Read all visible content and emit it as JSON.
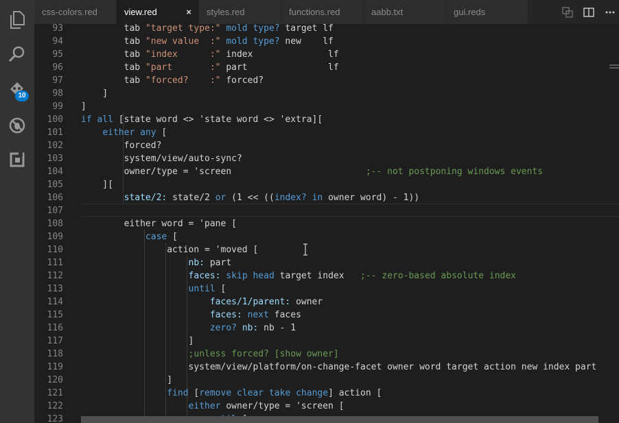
{
  "activity_bar": {
    "items": [
      {
        "name": "explorer-icon"
      },
      {
        "name": "search-icon"
      },
      {
        "name": "source-control-icon",
        "badge": "10"
      },
      {
        "name": "debug-icon"
      },
      {
        "name": "extensions-icon"
      }
    ]
  },
  "tabs": [
    {
      "label": "css-colors.red",
      "active": false
    },
    {
      "label": "view.red",
      "active": true,
      "close": "×"
    },
    {
      "label": "styles.red",
      "active": false
    },
    {
      "label": "functions.red",
      "active": false
    },
    {
      "label": "aabb.txt",
      "active": false
    },
    {
      "label": "gui.reds",
      "active": false
    }
  ],
  "tab_actions": [
    "open-changes-icon",
    "split-editor-icon",
    "more-actions-icon"
  ],
  "editor": {
    "lines": [
      {
        "n": "93",
        "tokens": [
          [
            "t",
            "        tab "
          ],
          [
            "s",
            "\"target type:\""
          ],
          [
            "t",
            " "
          ],
          [
            "k",
            "mold"
          ],
          [
            "t",
            " "
          ],
          [
            "k",
            "type?"
          ],
          [
            "t",
            " target "
          ],
          [
            "t",
            "lf"
          ]
        ]
      },
      {
        "n": "94",
        "tokens": [
          [
            "t",
            "        tab "
          ],
          [
            "s",
            "\"new value  :\""
          ],
          [
            "t",
            " "
          ],
          [
            "k",
            "mold"
          ],
          [
            "t",
            " "
          ],
          [
            "k",
            "type?"
          ],
          [
            "t",
            " new    "
          ],
          [
            "t",
            "lf"
          ]
        ]
      },
      {
        "n": "95",
        "tokens": [
          [
            "t",
            "        tab "
          ],
          [
            "s",
            "\"index      :\""
          ],
          [
            "t",
            " index              "
          ],
          [
            "t",
            "lf"
          ]
        ]
      },
      {
        "n": "96",
        "tokens": [
          [
            "t",
            "        tab "
          ],
          [
            "s",
            "\"part       :\""
          ],
          [
            "t",
            " part               "
          ],
          [
            "t",
            "lf"
          ]
        ]
      },
      {
        "n": "97",
        "tokens": [
          [
            "t",
            "        tab "
          ],
          [
            "s",
            "\"forced?    :\""
          ],
          [
            "t",
            " forced?"
          ]
        ]
      },
      {
        "n": "98",
        "tokens": [
          [
            "t",
            "    ]"
          ]
        ]
      },
      {
        "n": "99",
        "tokens": [
          [
            "t",
            "]"
          ]
        ]
      },
      {
        "n": "100",
        "tokens": [
          [
            "k",
            "if"
          ],
          [
            "t",
            " "
          ],
          [
            "k",
            "all"
          ],
          [
            "t",
            " [state word <> 'state word <> 'extra]["
          ]
        ]
      },
      {
        "n": "101",
        "tokens": [
          [
            "t",
            "    "
          ],
          [
            "k",
            "either"
          ],
          [
            "t",
            " "
          ],
          [
            "k",
            "any"
          ],
          [
            "t",
            " ["
          ]
        ]
      },
      {
        "n": "102",
        "tokens": [
          [
            "t",
            "        forced?"
          ]
        ]
      },
      {
        "n": "103",
        "tokens": [
          [
            "t",
            "        system/view/auto-sync?"
          ]
        ]
      },
      {
        "n": "104",
        "tokens": [
          [
            "t",
            "        owner/type = 'screen                         "
          ],
          [
            "c",
            ";-- not postponing windows events"
          ]
        ]
      },
      {
        "n": "105",
        "tokens": [
          [
            "t",
            "    ]["
          ]
        ]
      },
      {
        "n": "106",
        "tokens": [
          [
            "t",
            "        "
          ],
          [
            "w",
            "state/2:"
          ],
          [
            "t",
            " state/2 "
          ],
          [
            "k",
            "or"
          ],
          [
            "t",
            " (1 << (("
          ],
          [
            "k",
            "index?"
          ],
          [
            "t",
            " "
          ],
          [
            "k",
            "in"
          ],
          [
            "t",
            " owner word) - 1))"
          ]
        ]
      },
      {
        "n": "107",
        "tokens": []
      },
      {
        "n": "108",
        "tokens": [
          [
            "t",
            "        either word = 'pane ["
          ]
        ]
      },
      {
        "n": "109",
        "tokens": [
          [
            "t",
            "            "
          ],
          [
            "k",
            "case"
          ],
          [
            "t",
            " ["
          ]
        ]
      },
      {
        "n": "110",
        "tokens": [
          [
            "t",
            "                action = 'moved ["
          ]
        ]
      },
      {
        "n": "111",
        "tokens": [
          [
            "t",
            "                    "
          ],
          [
            "w",
            "nb:"
          ],
          [
            "t",
            " part"
          ]
        ]
      },
      {
        "n": "112",
        "tokens": [
          [
            "t",
            "                    "
          ],
          [
            "w",
            "faces:"
          ],
          [
            "t",
            " "
          ],
          [
            "k",
            "skip"
          ],
          [
            "t",
            " "
          ],
          [
            "k",
            "head"
          ],
          [
            "t",
            " target index   "
          ],
          [
            "c",
            ";-- zero-based absolute index"
          ]
        ]
      },
      {
        "n": "113",
        "tokens": [
          [
            "t",
            "                    "
          ],
          [
            "k",
            "until"
          ],
          [
            "t",
            " ["
          ]
        ]
      },
      {
        "n": "114",
        "tokens": [
          [
            "t",
            "                        "
          ],
          [
            "w",
            "faces/1/parent:"
          ],
          [
            "t",
            " owner"
          ]
        ]
      },
      {
        "n": "115",
        "tokens": [
          [
            "t",
            "                        "
          ],
          [
            "w",
            "faces:"
          ],
          [
            "t",
            " "
          ],
          [
            "k",
            "next"
          ],
          [
            "t",
            " faces"
          ]
        ]
      },
      {
        "n": "116",
        "tokens": [
          [
            "t",
            "                        "
          ],
          [
            "k",
            "zero?"
          ],
          [
            "t",
            " "
          ],
          [
            "w",
            "nb:"
          ],
          [
            "t",
            " nb - 1"
          ]
        ]
      },
      {
        "n": "117",
        "tokens": [
          [
            "t",
            "                    ]"
          ]
        ]
      },
      {
        "n": "118",
        "tokens": [
          [
            "t",
            "                    "
          ],
          [
            "c",
            ";unless forced? [show owner]"
          ]
        ]
      },
      {
        "n": "119",
        "tokens": [
          [
            "t",
            "                    system/view/platform/on-change-facet owner word target action new index part"
          ]
        ]
      },
      {
        "n": "120",
        "tokens": [
          [
            "t",
            "                ]"
          ]
        ]
      },
      {
        "n": "121",
        "tokens": [
          [
            "t",
            "                "
          ],
          [
            "k",
            "find"
          ],
          [
            "t",
            " ["
          ],
          [
            "k",
            "remove"
          ],
          [
            "t",
            " "
          ],
          [
            "k",
            "clear"
          ],
          [
            "t",
            " "
          ],
          [
            "k",
            "take"
          ],
          [
            "t",
            " "
          ],
          [
            "k",
            "change"
          ],
          [
            "t",
            "] action ["
          ]
        ]
      },
      {
        "n": "122",
        "tokens": [
          [
            "t",
            "                    "
          ],
          [
            "k",
            "either"
          ],
          [
            "t",
            " owner/type = 'screen ["
          ]
        ]
      },
      {
        "n": "123",
        "tokens": [
          [
            "t",
            "                        "
          ],
          [
            "k",
            "until"
          ],
          [
            "t",
            " ["
          ]
        ]
      }
    ]
  },
  "colors": {
    "keyword": "#569cd6",
    "string": "#ce9178",
    "comment": "#6a9955",
    "set_word": "#9cdcfe",
    "text": "#d4d4d4",
    "line_number": "#858585",
    "badge": "#007acc"
  }
}
